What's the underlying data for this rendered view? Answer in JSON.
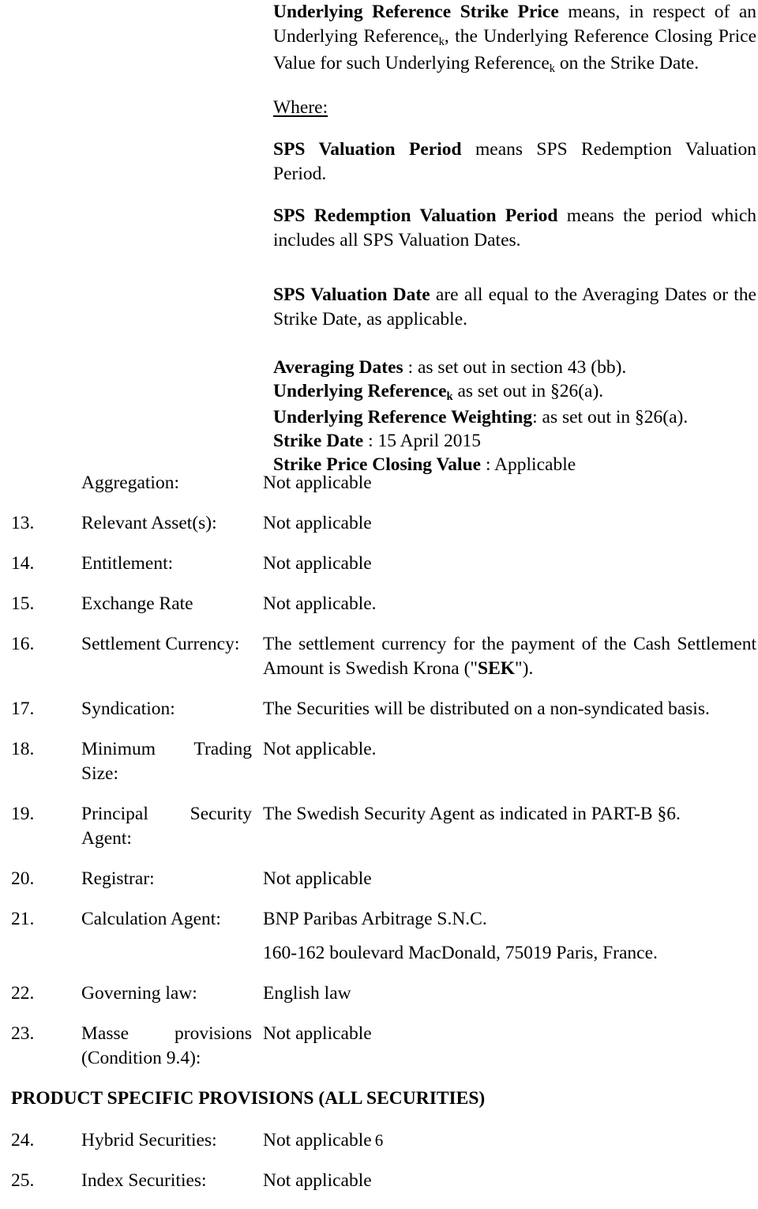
{
  "definitions": {
    "strike_price_def": {
      "term": "Underlying Reference Strike Price",
      "body_1": " means, in respect of an Underlying Reference",
      "sub_1": "k",
      "body_2": ", the Underlying Reference Closing Price Value for such Underlying Reference",
      "sub_2": "k",
      "body_3": " on the Strike Date."
    },
    "where_label": "Where:",
    "sps_valuation_period": {
      "term": "SPS Valuation Period",
      "body": " means SPS Redemption Valuation Period."
    },
    "sps_redemption_valuation_period": {
      "term": "SPS Redemption Valuation Period",
      "body": " means the period which includes all SPS Valuation Dates."
    },
    "sps_valuation_date": {
      "term": "SPS Valuation Date",
      "body": " are all equal to the Averaging Dates or the Strike Date, as applicable."
    },
    "short_terms": [
      {
        "term": "Averaging  Dates",
        "body": " : as set out in section 43 (bb)."
      },
      {
        "term": "Underlying Reference",
        "sub": "k",
        "body": " as set out in §26(a)."
      },
      {
        "term": "Underlying Reference Weighting",
        "body": ": as set out in §26(a)."
      },
      {
        "term": "Strike Date",
        "body": " : 15 April 2015"
      },
      {
        "term": "Strike Price Closing Value",
        "body": " : Applicable"
      }
    ]
  },
  "items": [
    {
      "number": "",
      "label": "Aggregation:",
      "label_spread": false,
      "value": "Not applicable"
    },
    {
      "number": "13.",
      "label": "Relevant Asset(s):",
      "label_spread": false,
      "value": "Not applicable"
    },
    {
      "number": "14.",
      "label": "Entitlement:",
      "label_spread": false,
      "value": "Not applicable"
    },
    {
      "number": "15.",
      "label": "Exchange Rate",
      "label_spread": false,
      "value": "Not applicable."
    },
    {
      "number": "16.",
      "label": "Settlement Currency:",
      "label_spread": false,
      "value_pre": "The settlement currency for the payment of the Cash Settlement Amount is Swedish Krona (\"",
      "value_bold": "SEK",
      "value_post": "\")."
    },
    {
      "number": "17.",
      "label": "Syndication:",
      "label_spread": false,
      "value": "The Securities will be distributed on a non-syndicated basis."
    },
    {
      "number": "18.",
      "label": "Minimum Trading",
      "label_line2": "Size:",
      "label_spread": true,
      "value": "Not applicable."
    },
    {
      "number": "19.",
      "label": "Principal Security",
      "label_line2": "Agent:",
      "label_spread": true,
      "value": "The Swedish Security Agent as indicated in PART-B §6."
    },
    {
      "number": "20.",
      "label": "Registrar:",
      "label_spread": false,
      "value": "Not applicable"
    },
    {
      "number": "21.",
      "label": "Calculation Agent:",
      "label_spread": false,
      "value": "BNP Paribas Arbitrage S.N.C.",
      "value_line2": "160-162 boulevard MacDonald, 75019 Paris, France."
    },
    {
      "number": "22.",
      "label": "Governing law:",
      "label_spread": false,
      "value": "English law"
    },
    {
      "number": "23.",
      "label": "Masse provisions",
      "label_line2": "(Condition 9.4):",
      "label_spread": true,
      "value": "Not applicable"
    }
  ],
  "section_heading": "PRODUCT SPECIFIC PROVISIONS (ALL SECURITIES)",
  "items_after_heading": [
    {
      "number": "24.",
      "label": "Hybrid Securities:",
      "label_spread": false,
      "value": "Not applicable"
    },
    {
      "number": "25.",
      "label": "Index Securities:",
      "label_spread": false,
      "value": "Not applicable"
    }
  ],
  "footer": {
    "page_number": "6"
  }
}
